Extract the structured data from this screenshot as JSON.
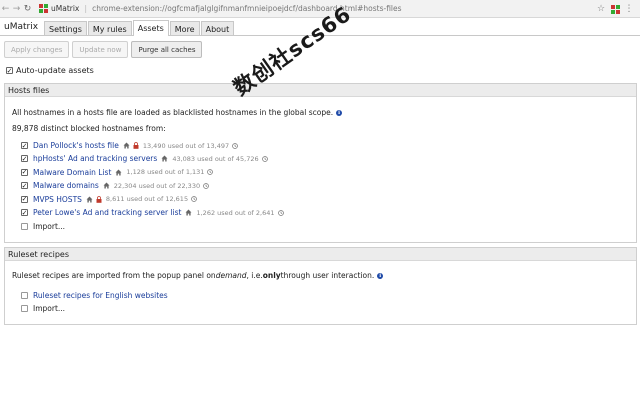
{
  "browser": {
    "back_icon": "arrow-left-icon",
    "forward_icon": "arrow-right-icon",
    "reload_icon": "reload-icon",
    "site_name": "uMatrix",
    "url": "chrome-extension://ogfcmafjalglgifnmanfmnieipoejdcf/dashboard.html#hosts-files"
  },
  "tabbar": {
    "app_title": "uMatrix",
    "tabs": [
      {
        "label": "Settings",
        "active": false
      },
      {
        "label": "My rules",
        "active": false
      },
      {
        "label": "Assets",
        "active": true
      },
      {
        "label": "More",
        "active": false
      },
      {
        "label": "About",
        "active": false
      }
    ]
  },
  "toolbar": {
    "apply_label": "Apply changes",
    "update_label": "Update now",
    "purge_label": "Purge all caches"
  },
  "auto_update": {
    "label": "Auto-update assets",
    "checked": true
  },
  "hosts": {
    "title": "Hosts files",
    "intro": "All hostnames in a hosts file are loaded as blacklisted hostnames in the global scope.",
    "count_text": "89,878 distinct blocked hostnames from:",
    "items": [
      {
        "name": "Dan Pollock's hosts file",
        "used": "13,490 used out of 13,497",
        "checked": true,
        "lock": true
      },
      {
        "name": "hpHosts' Ad and tracking servers",
        "used": "43,083 used out of 45,726",
        "checked": true,
        "lock": false
      },
      {
        "name": "Malware Domain List",
        "used": "1,128 used out of 1,131",
        "checked": true,
        "lock": false
      },
      {
        "name": "Malware domains",
        "used": "22,304 used out of 22,330",
        "checked": true,
        "lock": false
      },
      {
        "name": "MVPS HOSTS",
        "used": "8,611 used out of 12,615",
        "checked": true,
        "lock": true
      },
      {
        "name": "Peter Lowe's Ad and tracking server list",
        "used": "1,262 used out of 2,641",
        "checked": true,
        "lock": false
      }
    ],
    "import_label": "Import..."
  },
  "recipes": {
    "title": "Ruleset recipes",
    "intro_before": "Ruleset recipes are imported from the popup panel on ",
    "intro_em": "demand",
    "intro_mid": ", i.e. ",
    "intro_strong": "only",
    "intro_after": " through user interaction.",
    "item_label": "Ruleset recipes for English websites",
    "import_label": "Import..."
  },
  "watermark": "数创社scs66",
  "colors": {
    "link": "#1a3d9a",
    "info": "#1f4aa8",
    "lock": "#c0392b"
  }
}
